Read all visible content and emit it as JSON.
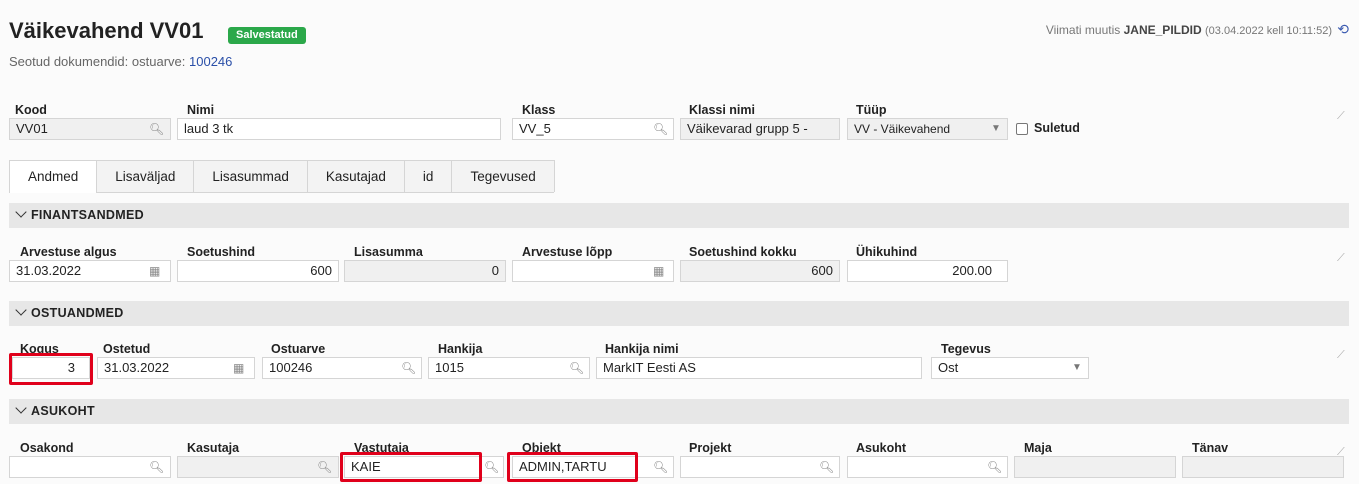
{
  "header": {
    "title": "Väikevahend VV01",
    "status": "Salvestatud",
    "linked_label": "Seotud dokumendid:",
    "linked_type": "ostuarve:",
    "linked_number": "100246",
    "modified_prefix": "Viimati muutis",
    "modified_user": "JANE_PILDID",
    "modified_time": "(03.04.2022 kell 10:11:52)"
  },
  "top": {
    "kood_label": "Kood",
    "kood_value": "VV01",
    "nimi_label": "Nimi",
    "nimi_value": "laud 3 tk",
    "klass_label": "Klass",
    "klass_value": "VV_5",
    "klassi_nimi_label": "Klassi nimi",
    "klassi_nimi_value": "Väikevarad grupp 5 -",
    "tyyp_label": "Tüüp",
    "tyyp_value": "VV - Väikevahend",
    "suletud_label": "Suletud"
  },
  "tabs": [
    "Andmed",
    "Lisaväljad",
    "Lisasummad",
    "Kasutajad",
    "id",
    "Tegevused"
  ],
  "finants": {
    "section": "FINANTSANDMED",
    "arvestuse_algus_label": "Arvestuse algus",
    "arvestuse_algus": "31.03.2022",
    "soetushind_label": "Soetushind",
    "soetushind": "600",
    "lisasumma_label": "Lisasumma",
    "lisasumma": "0",
    "arvestuse_lopp_label": "Arvestuse lõpp",
    "arvestuse_lopp": "",
    "soetushind_kokku_label": "Soetushind kokku",
    "soetushind_kokku": "600",
    "uhikuhind_label": "Ühikuhind",
    "uhikuhind": "200.00"
  },
  "ostu": {
    "section": "OSTUANDMED",
    "kogus_label": "Kogus",
    "kogus": "3",
    "ostetud_label": "Ostetud",
    "ostetud": "31.03.2022",
    "ostuarve_label": "Ostuarve",
    "ostuarve": "100246",
    "hankija_label": "Hankija",
    "hankija": "1015",
    "hankija_nimi_label": "Hankija nimi",
    "hankija_nimi": "MarkIT Eesti AS",
    "tegevus_label": "Tegevus",
    "tegevus": "Ost"
  },
  "asukoht": {
    "section": "ASUKOHT",
    "osakond_label": "Osakond",
    "osakond": "",
    "kasutaja_label": "Kasutaja",
    "kasutaja": "",
    "vastutaja_label": "Vastutaja",
    "vastutaja": "KAIE",
    "objekt_label": "Objekt",
    "objekt": "ADMIN,TARTU",
    "projekt_label": "Projekt",
    "projekt": "",
    "asukoht_label": "Asukoht",
    "asukoht": "",
    "maja_label": "Maja",
    "maja": "",
    "tanav_label": "Tänav",
    "tanav": ""
  },
  "colors": {
    "badge": "#2ba84a",
    "highlight": "#e0001b",
    "link": "#2a4fa8"
  },
  "icons": [
    "search-icon",
    "calendar-icon",
    "dropdown-arrow-icon",
    "history-icon",
    "pin-icon",
    "chevron-down-icon"
  ]
}
